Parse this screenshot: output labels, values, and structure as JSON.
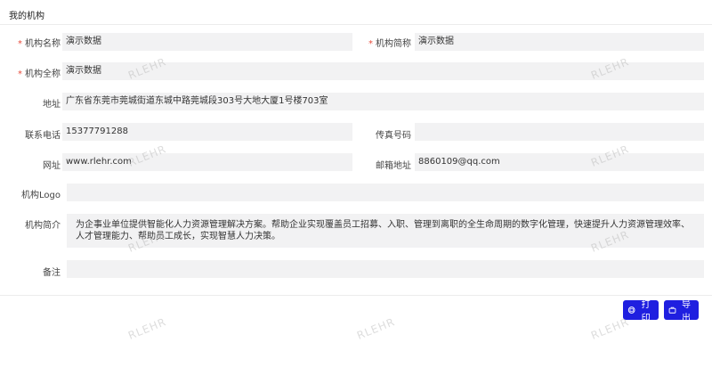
{
  "header": {
    "title": "我的机构"
  },
  "form": {
    "org_name": {
      "label": "机构名称",
      "value": "演示数据",
      "required": true
    },
    "org_short": {
      "label": "机构简称",
      "value": "演示数据",
      "required": true
    },
    "org_full": {
      "label": "机构全称",
      "value": "演示数据",
      "required": true
    },
    "address": {
      "label": "地址",
      "value": "广东省东莞市莞城街道东城中路莞城段303号大地大厦1号楼703室"
    },
    "phone": {
      "label": "联系电话",
      "value": "15377791288"
    },
    "fax": {
      "label": "传真号码",
      "value": ""
    },
    "website": {
      "label": "网址",
      "value": "www.rlehr.com"
    },
    "email": {
      "label": "邮箱地址",
      "value": "8860109@qq.com"
    },
    "logo": {
      "label": "机构Logo",
      "value": ""
    },
    "intro": {
      "label": "机构简介",
      "value": "为企事业单位提供智能化人力资源管理解决方案。帮助企业实现覆盖员工招募、入职、管理到离职的全生命周期的数字化管理，快速提升人力资源管理效率、人才管理能力、帮助员工成长，实现智慧人力决策。"
    },
    "remark": {
      "label": "备注",
      "value": ""
    }
  },
  "actions": {
    "print_label": "打印",
    "export_label": "导出"
  },
  "watermark": "RLEHR",
  "colors": {
    "accent": "#1f1fe0",
    "required": "#e74c3c",
    "field_bg": "#f2f2f3"
  }
}
